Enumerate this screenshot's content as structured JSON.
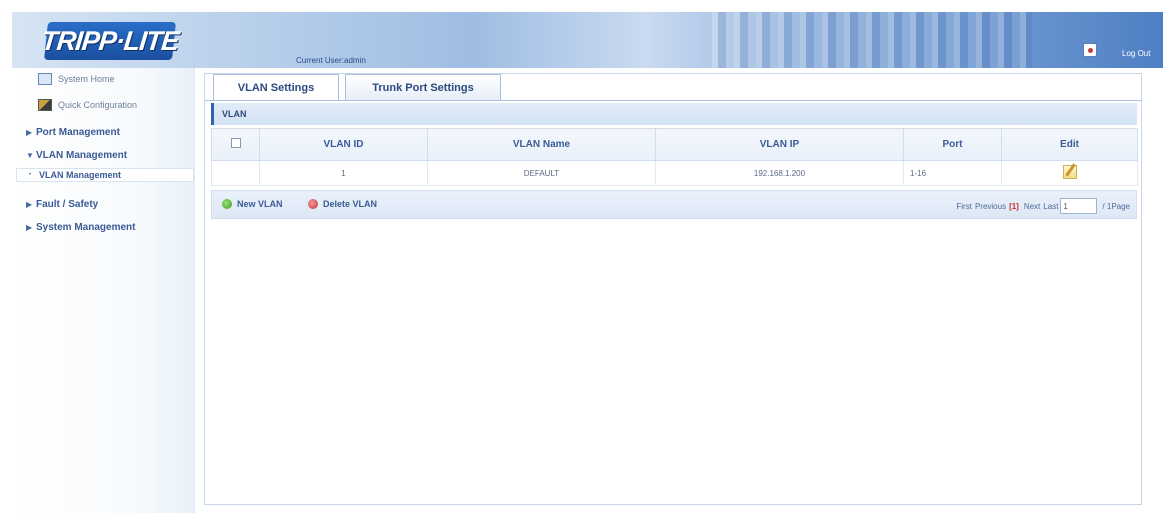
{
  "header": {
    "logo": "TRIPP·LITE",
    "current_user": "Current User:admin",
    "logout": "Log Out"
  },
  "sidebar": {
    "items": [
      {
        "label": "System Home",
        "icon": "home-icon"
      },
      {
        "label": "Quick Configuration",
        "icon": "quick-config-icon"
      },
      {
        "label": "Port Management"
      },
      {
        "label": "VLAN Management"
      },
      {
        "label": "VLAN Management"
      },
      {
        "label": "Fault / Safety"
      },
      {
        "label": "System Management"
      }
    ]
  },
  "tabs": [
    {
      "label": "VLAN Settings",
      "active": true
    },
    {
      "label": "Trunk Port Settings",
      "active": false
    }
  ],
  "section": {
    "title": "VLAN"
  },
  "table": {
    "headers": [
      "VLAN ID",
      "VLAN Name",
      "VLAN IP",
      "Port",
      "Edit"
    ],
    "rows": [
      {
        "id": "1",
        "name": "DEFAULT",
        "ip": "192.168.1.200",
        "port": "1-16"
      }
    ]
  },
  "actions": {
    "new_vlan": "New VLAN",
    "delete_vlan": "Delete VLAN"
  },
  "pager": {
    "first": "First",
    "previous": "Previous",
    "current": "[1]",
    "next": "Next",
    "last": "Last",
    "page_value": "1",
    "total": "/ 1Page"
  },
  "colors": {
    "accent": "#2f64b0",
    "header_dark": "#4e7fc4"
  }
}
